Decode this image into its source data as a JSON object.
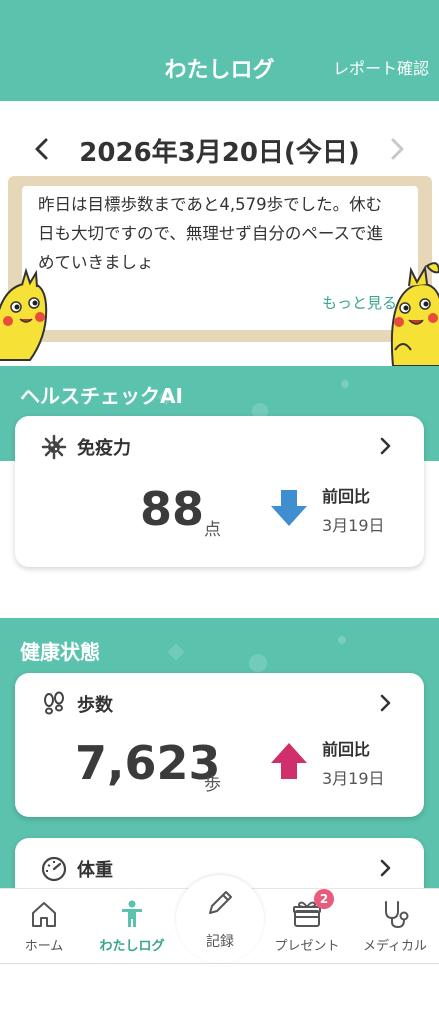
{
  "header": {
    "title": "わたしログ",
    "report_link": "レポート確認"
  },
  "date_nav": {
    "date_text": "2026年3月20日(今日)",
    "prev_icon": "chevron-left-icon",
    "next_icon": "chevron-right-icon"
  },
  "message": {
    "text": "昨日は目標歩数まであと4,579歩でした。休む日も大切ですので、無理せず自分のペースで進めていきましょ",
    "more_label": "もっと見る"
  },
  "health_check": {
    "section_title": "ヘルスチェックAI",
    "card": {
      "title": "免疫力",
      "value": "88",
      "unit": "点",
      "trend": "down",
      "compare_label": "前回比",
      "compare_date": "3月19日"
    }
  },
  "health_status": {
    "section_title": "健康状態",
    "steps_card": {
      "title": "歩数",
      "value": "7,623",
      "unit": "歩",
      "trend": "up",
      "compare_label": "前回比",
      "compare_date": "3月19日"
    },
    "weight_card": {
      "title": "体重"
    }
  },
  "bottom_nav": {
    "items": [
      {
        "label": "ホーム",
        "icon": "home-icon"
      },
      {
        "label": "わたしログ",
        "icon": "person-icon",
        "active": true
      },
      {
        "label": "記録",
        "icon": "pencil-icon"
      },
      {
        "label": "プレゼント",
        "icon": "gift-icon",
        "badge": "2"
      },
      {
        "label": "メディカル",
        "icon": "stethoscope-icon"
      }
    ]
  },
  "colors": {
    "accent": "#5bc2ad",
    "accent_dark": "#3aa58f",
    "down_arrow": "#3f8fd0",
    "up_arrow": "#d12e6c",
    "badge": "#e95a7c"
  }
}
